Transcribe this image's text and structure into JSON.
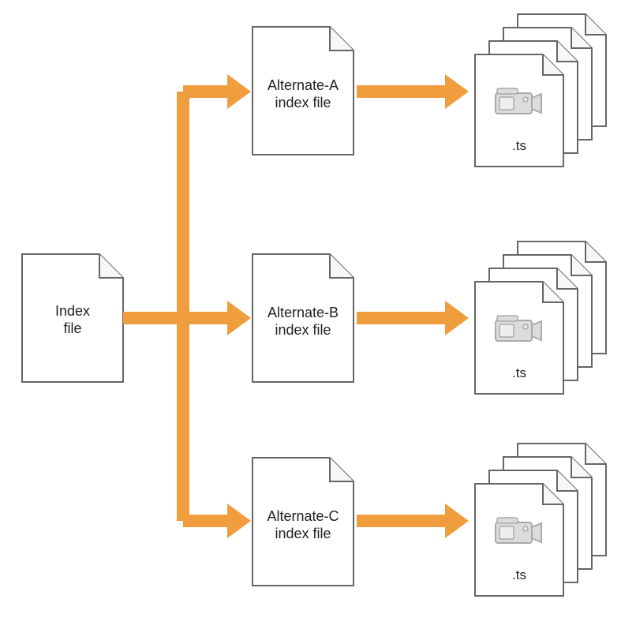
{
  "root": {
    "label_line1": "Index",
    "label_line2": "file"
  },
  "alternates": [
    {
      "label_line1": "Alternate-A",
      "label_line2": "index file"
    },
    {
      "label_line1": "Alternate-B",
      "label_line2": "index file"
    },
    {
      "label_line1": "Alternate-C",
      "label_line2": "index file"
    }
  ],
  "segment_extension": ".ts",
  "colors": {
    "arrow": "#f09d3e",
    "file_stroke": "#666",
    "camera_fill": "#dcdcdc",
    "camera_stroke": "#aaa"
  }
}
